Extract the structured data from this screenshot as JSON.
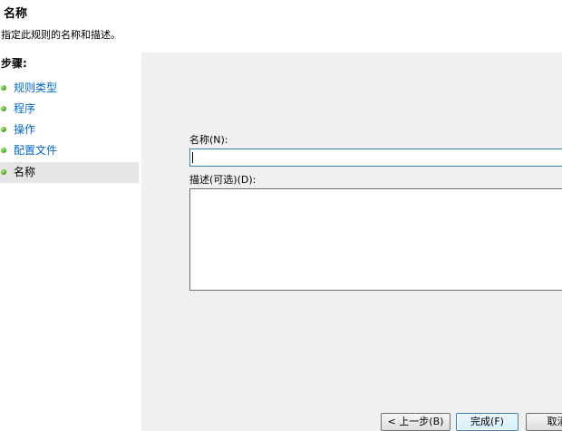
{
  "header": {
    "title": "名称",
    "description": "指定此规则的名称和描述。"
  },
  "sidebar": {
    "title": "步骤:",
    "items": [
      {
        "label": "规则类型",
        "icon": "green-dot-icon"
      },
      {
        "label": "程序",
        "icon": "green-dot-icon"
      },
      {
        "label": "操作",
        "icon": "green-dot-icon"
      },
      {
        "label": "配置文件",
        "icon": "green-dot-icon"
      },
      {
        "label": "名称",
        "icon": "green-dot-icon",
        "active": true
      }
    ]
  },
  "form": {
    "name_label": "名称(N):",
    "name_value": "",
    "description_label": "描述(可选)(D):",
    "description_value": ""
  },
  "buttons": {
    "back": "< 上一步(B)",
    "finish": "完成(F)",
    "cancel": "取消"
  },
  "colors": {
    "link": "#0066cc",
    "active_step_bg": "#e5e5e5",
    "content_bg": "#f0f0f0",
    "focus_border": "#3c7fb1"
  }
}
